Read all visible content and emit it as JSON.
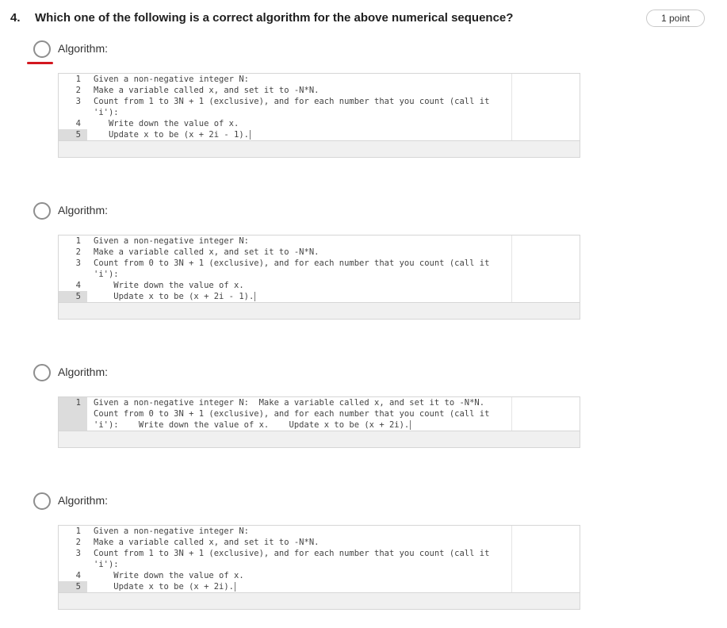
{
  "question": {
    "number": "4.",
    "text": "Which one of the following is a correct algorithm for the above numerical sequence?",
    "points": "1 point"
  },
  "options": [
    {
      "label": "Algorithm:",
      "lines": [
        {
          "n": "1",
          "t": "Given a non-negative integer N:"
        },
        {
          "n": "2",
          "t": "Make a variable called x, and set it to -N*N."
        },
        {
          "n": "3",
          "t": "Count from 1 to 3N + 1 (exclusive), and for each number that you count (call it"
        },
        {
          "n": "",
          "t": "'i'):"
        },
        {
          "n": "4",
          "t": "   Write down the value of x."
        },
        {
          "n": "5",
          "t": "   Update x to be (x + 2i - 1)."
        }
      ]
    },
    {
      "label": "Algorithm:",
      "lines": [
        {
          "n": "1",
          "t": "Given a non-negative integer N:"
        },
        {
          "n": "2",
          "t": "Make a variable called x, and set it to -N*N."
        },
        {
          "n": "3",
          "t": "Count from 0 to 3N + 1 (exclusive), and for each number that you count (call it"
        },
        {
          "n": "",
          "t": "'i'):"
        },
        {
          "n": "4",
          "t": "    Write down the value of x."
        },
        {
          "n": "5",
          "t": "    Update x to be (x + 2i - 1)."
        }
      ]
    },
    {
      "label": "Algorithm:",
      "lines": [
        {
          "n": "1",
          "t": "Given a non-negative integer N:  Make a variable called x, and set it to -N*N."
        },
        {
          "n": "",
          "t": "Count from 0 to 3N + 1 (exclusive), and for each number that you count (call it"
        },
        {
          "n": "",
          "t": "'i'):    Write down the value of x.    Update x to be (x + 2i)."
        }
      ]
    },
    {
      "label": "Algorithm:",
      "lines": [
        {
          "n": "1",
          "t": "Given a non-negative integer N:"
        },
        {
          "n": "2",
          "t": "Make a variable called x, and set it to -N*N."
        },
        {
          "n": "3",
          "t": "Count from 1 to 3N + 1 (exclusive), and for each number that you count (call it"
        },
        {
          "n": "",
          "t": "'i'):"
        },
        {
          "n": "4",
          "t": "    Write down the value of x."
        },
        {
          "n": "5",
          "t": "    Update x to be (x + 2i)."
        }
      ]
    }
  ]
}
